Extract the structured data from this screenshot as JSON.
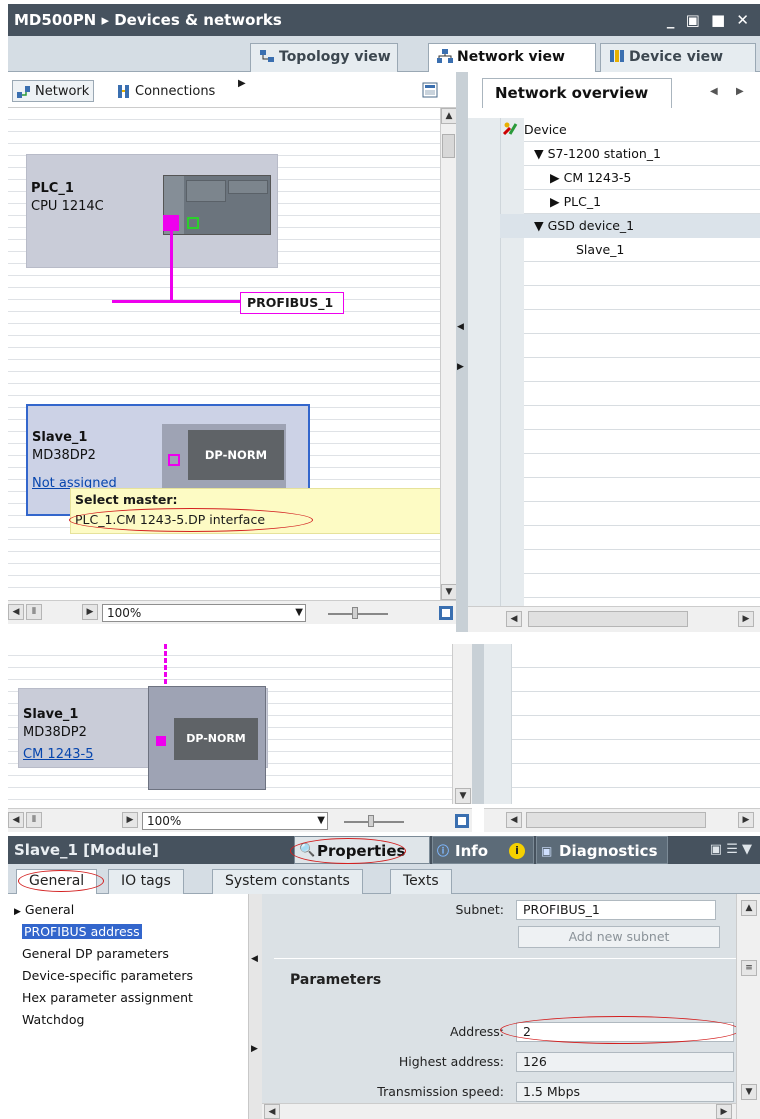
{
  "window": {
    "title": "MD500PN  ▸  Devices & networks",
    "controls": "_ ▣ ■ ✕"
  },
  "view_tabs": {
    "topology": "Topology view",
    "network": "Network view",
    "device": "Device view"
  },
  "toolbar": {
    "network": "Network",
    "connections": "Connections"
  },
  "overview": {
    "tab": "Network overview",
    "header": "Device",
    "tree": [
      {
        "label": "S7-1200 station_1",
        "expander": "▼"
      },
      {
        "label": "CM 1243-5",
        "expander": "▶"
      },
      {
        "label": "PLC_1",
        "expander": "▶"
      },
      {
        "label": "GSD device_1",
        "expander": "▼"
      },
      {
        "label": "Slave_1",
        "expander": ""
      }
    ]
  },
  "plc": {
    "name": "PLC_1",
    "cpu": "CPU 1214C"
  },
  "bus": {
    "label": "PROFIBUS_1"
  },
  "slave": {
    "name": "Slave_1",
    "model": "MD38DP2",
    "module": "DP-NORM",
    "status": "Not assigned"
  },
  "tooltip": {
    "title": "Select master:",
    "value": "PLC_1.CM 1243-5.DP interface"
  },
  "zoom": {
    "value": "100%"
  },
  "slave2": {
    "name": "Slave_1",
    "model": "MD38DP2",
    "module": "DP-NORM",
    "master": "CM 1243-5"
  },
  "inspector": {
    "title": "Slave_1 [Module]",
    "tabs": {
      "properties": "Properties",
      "info": "Info",
      "diagnostics": "Diagnostics"
    },
    "subtabs": [
      "General",
      "IO tags",
      "System constants",
      "Texts"
    ],
    "nav": [
      "General",
      "PROFIBUS address",
      "General DP parameters",
      "Device-specific parameters",
      "Hex parameter assignment",
      "Watchdog"
    ],
    "subnet_label": "Subnet:",
    "subnet_value": "PROFIBUS_1",
    "add_subnet": "Add new subnet",
    "section": "Parameters",
    "address_label": "Address:",
    "address_value": "2",
    "highest_label": "Highest address:",
    "highest_value": "126",
    "speed_label": "Transmission speed:",
    "speed_value": "1.5 Mbps"
  },
  "colors": {
    "title_bar": "#46525e",
    "bus": "#ee00ee",
    "highlight": "#d32020",
    "tooltip": "#fdfbc4",
    "selection": "#3366cc"
  }
}
